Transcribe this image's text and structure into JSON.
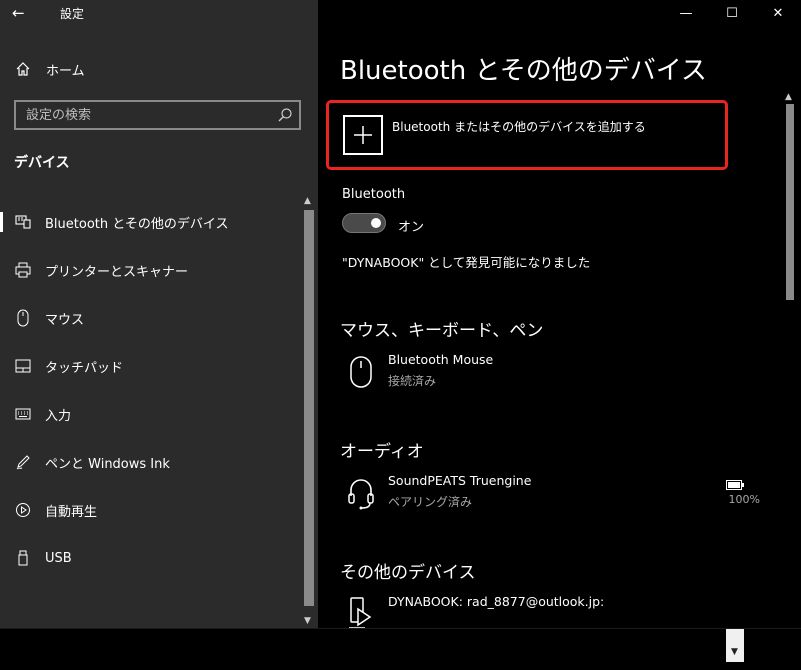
{
  "window": {
    "title": "設定"
  },
  "sidebar": {
    "home_label": "ホーム",
    "search_placeholder": "設定の検索",
    "section_title": "デバイス",
    "items": [
      {
        "label": "Bluetooth とその他のデバイス",
        "icon": "bluetooth-devices-icon",
        "selected": true
      },
      {
        "label": "プリンターとスキャナー",
        "icon": "printer-icon"
      },
      {
        "label": "マウス",
        "icon": "mouse-icon"
      },
      {
        "label": "タッチパッド",
        "icon": "touchpad-icon"
      },
      {
        "label": "入力",
        "icon": "keyboard-icon"
      },
      {
        "label": "ペンと Windows Ink",
        "icon": "pen-icon"
      },
      {
        "label": "自動再生",
        "icon": "autoplay-icon"
      },
      {
        "label": "USB",
        "icon": "usb-icon"
      }
    ]
  },
  "main": {
    "title": "Bluetooth とその他のデバイス",
    "add_device_label": "Bluetooth またはその他のデバイスを追加する",
    "bluetooth_label": "Bluetooth",
    "toggle_state": "オン",
    "discoverable_text": "\"DYNABOOK\" として発見可能になりました",
    "groups": {
      "mouse_keyboard_pen": {
        "heading": "マウス、キーボード、ペン",
        "device": {
          "name": "Bluetooth Mouse",
          "status": "接続済み"
        }
      },
      "audio": {
        "heading": "オーディオ",
        "device": {
          "name": "SoundPEATS Truengine",
          "status": "ペアリング済み",
          "battery": "100%"
        }
      },
      "other": {
        "heading": "その他のデバイス",
        "device": {
          "name": "DYNABOOK: rad_8877@outlook.jp:"
        }
      }
    }
  },
  "colors": {
    "highlight_border": "#e8251f",
    "sidebar_bg": "#2b2b2b",
    "main_bg": "#000000"
  }
}
